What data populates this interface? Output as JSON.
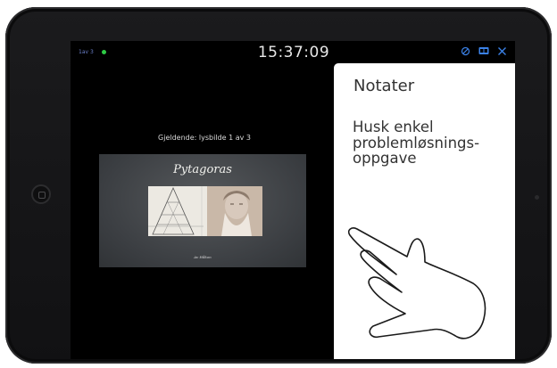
{
  "status": {
    "slide_count": "1av 3",
    "live_color": "#2ecb45",
    "clock": "15:37:09",
    "icons": [
      "pen-off-icon",
      "layout-toggle-icon",
      "close-icon"
    ],
    "accent_color": "#3b82e8"
  },
  "presenter": {
    "current_label": "Gjeldende: lysbilde 1 av 3",
    "slide": {
      "title": "Pytagoras",
      "author": "Av Håkon"
    }
  },
  "notes": {
    "title": "Notater",
    "body": "Husk enkel\nproblemløsnings-\noppgave",
    "gesture": "swipe-hand-icon"
  }
}
